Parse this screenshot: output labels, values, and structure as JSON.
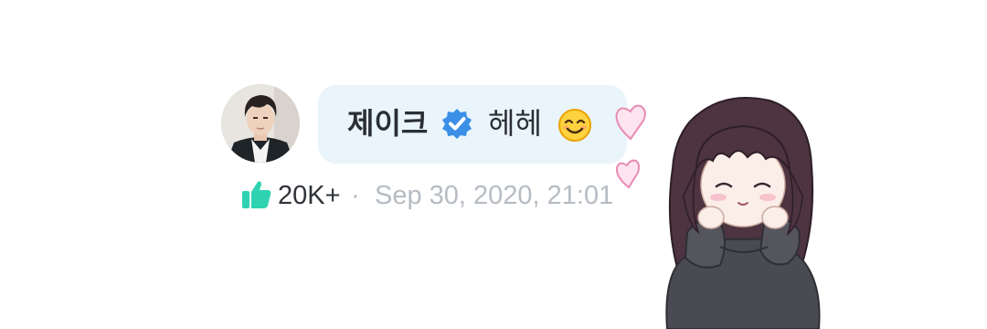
{
  "comment": {
    "author_name": "제이크",
    "verified_icon": "verified-badge-icon",
    "message": "헤헤",
    "emoji_icon": "smiling-face-icon",
    "likes": "20K+",
    "separator": "·",
    "timestamp": "Sep 30, 2020, 21:01"
  },
  "colors": {
    "bubble": "#e9f4fb",
    "verified": "#3b8fe6",
    "like": "#2fd3b2",
    "heart": "#f4b7d2",
    "meta_text": "#b6bcc3"
  }
}
